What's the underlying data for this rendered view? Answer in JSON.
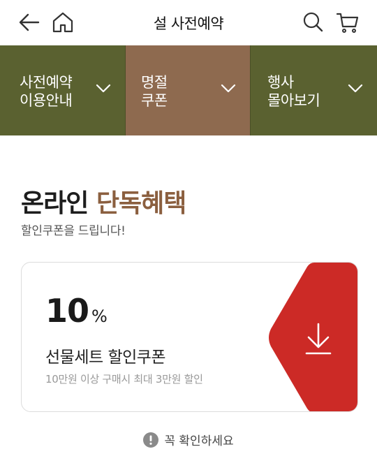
{
  "header": {
    "title": "설 사전예약",
    "icons": [
      "back-arrow-icon",
      "home-icon",
      "search-icon",
      "cart-icon"
    ]
  },
  "nav": {
    "items": [
      {
        "label": "사전예약\n이용안내"
      },
      {
        "label": "명절\n쿠폰"
      },
      {
        "label": "행사\n몰아보기"
      }
    ],
    "active_index": 1
  },
  "benefit": {
    "headline_main": "온라인",
    "headline_accent": "단독혜택",
    "subline": "할인쿠폰을 드립니다!"
  },
  "coupon": {
    "discount_value": "10",
    "discount_unit": "%",
    "name": "선물세트 할인쿠폰",
    "condition": "10만원 이상 구매시 최대 3만원 할인"
  },
  "notice": {
    "text": "꼭 확인하세요"
  },
  "colors": {
    "nav_bg": "#5a6130",
    "nav_active_bg": "#8e6a4f",
    "accent_text": "#8b5f3f",
    "coupon_download_bg": "#cc2a26"
  }
}
